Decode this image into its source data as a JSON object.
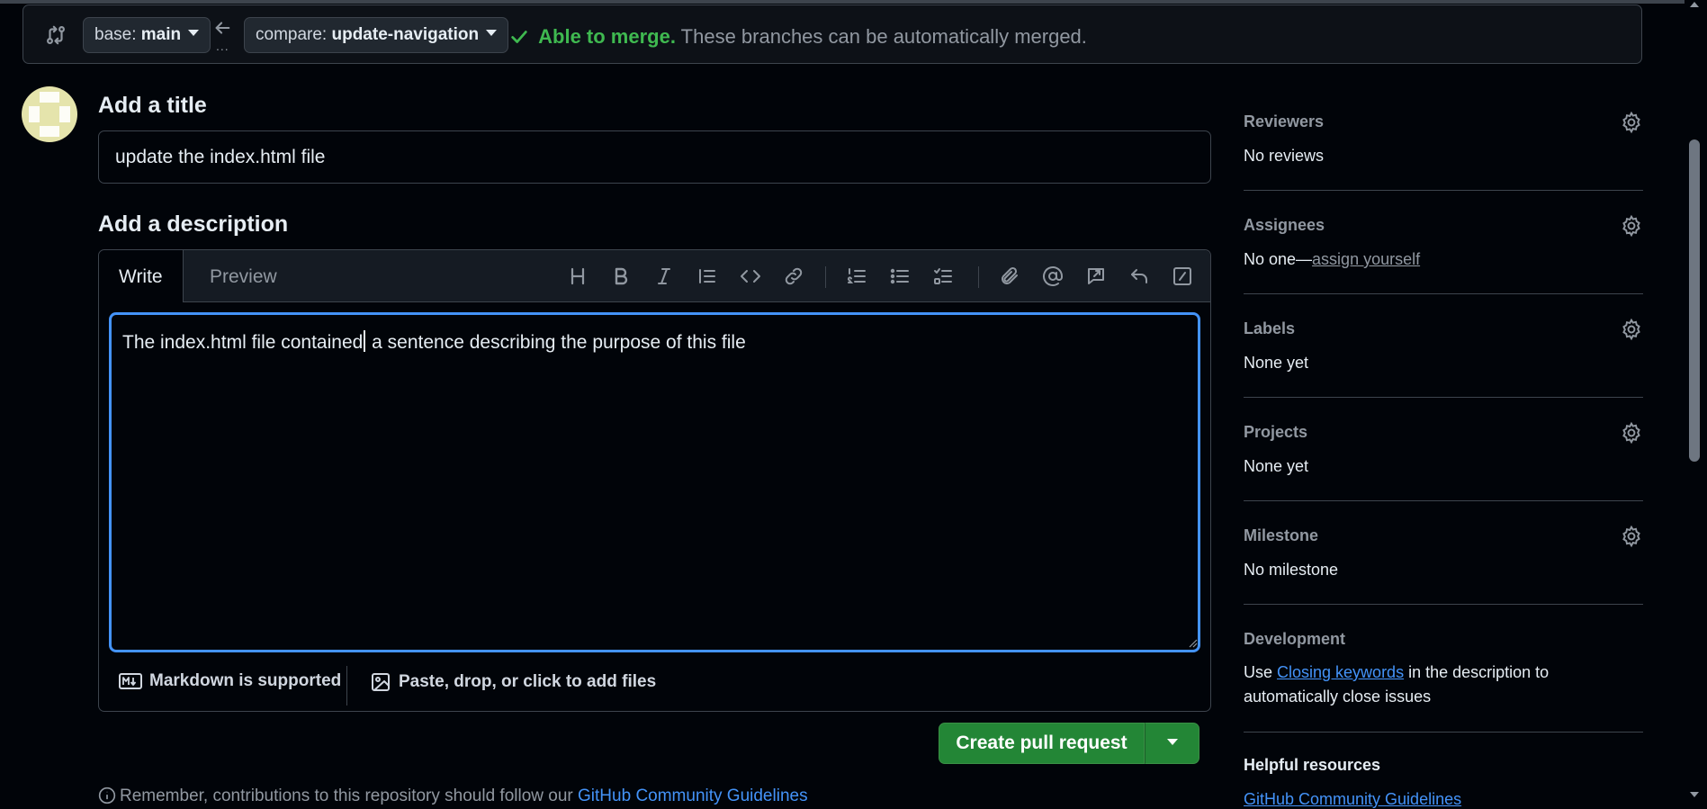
{
  "compare_bar": {
    "base_label": "base:",
    "base_value": "main",
    "compare_label": "compare:",
    "compare_value": "update-navigation",
    "dots": "...",
    "merge_ok": "Able to merge.",
    "merge_text": "These branches can be automatically merged."
  },
  "title_section": {
    "heading": "Add a title",
    "value": "update the index.html file"
  },
  "description_section": {
    "heading": "Add a description",
    "tabs": [
      "Write",
      "Preview"
    ],
    "active_tab": "Write",
    "text_before_cursor": "The index.html file contained",
    "text_after_cursor": " a sentence describing the purpose of this file",
    "markdown_note": "Markdown is supported",
    "attach_note": "Paste, drop, or click to add files"
  },
  "toolbar": {
    "icons": [
      "heading-icon",
      "bold-icon",
      "italic-icon",
      "quote-icon",
      "code-icon",
      "link-icon",
      "numbered-list-icon",
      "unordered-list-icon",
      "task-list-icon",
      "attach-icon",
      "mention-icon",
      "reference-icon",
      "undo-icon",
      "slash-command-icon"
    ]
  },
  "actions": {
    "create_label": "Create pull request"
  },
  "note": {
    "text": "Remember, contributions to this repository should follow our ",
    "link": "GitHub Community Guidelines"
  },
  "sidebar": {
    "reviewers": {
      "label": "Reviewers",
      "value": "No reviews"
    },
    "assignees": {
      "label": "Assignees",
      "value": "No one—",
      "link": "assign yourself"
    },
    "labels": {
      "label": "Labels",
      "value": "None yet"
    },
    "projects": {
      "label": "Projects",
      "value": "None yet"
    },
    "milestone": {
      "label": "Milestone",
      "value": "No milestone"
    },
    "development": {
      "label": "Development",
      "text_before": "Use ",
      "link": "Closing keywords",
      "text_after": " in the description to automatically close issues"
    },
    "helpful": {
      "label": "Helpful resources",
      "link": "GitHub Community Guidelines"
    }
  },
  "colors": {
    "accent_blue": "#4493f8",
    "success_green": "#3fb950",
    "button_green": "#238636",
    "background": "#010409"
  }
}
